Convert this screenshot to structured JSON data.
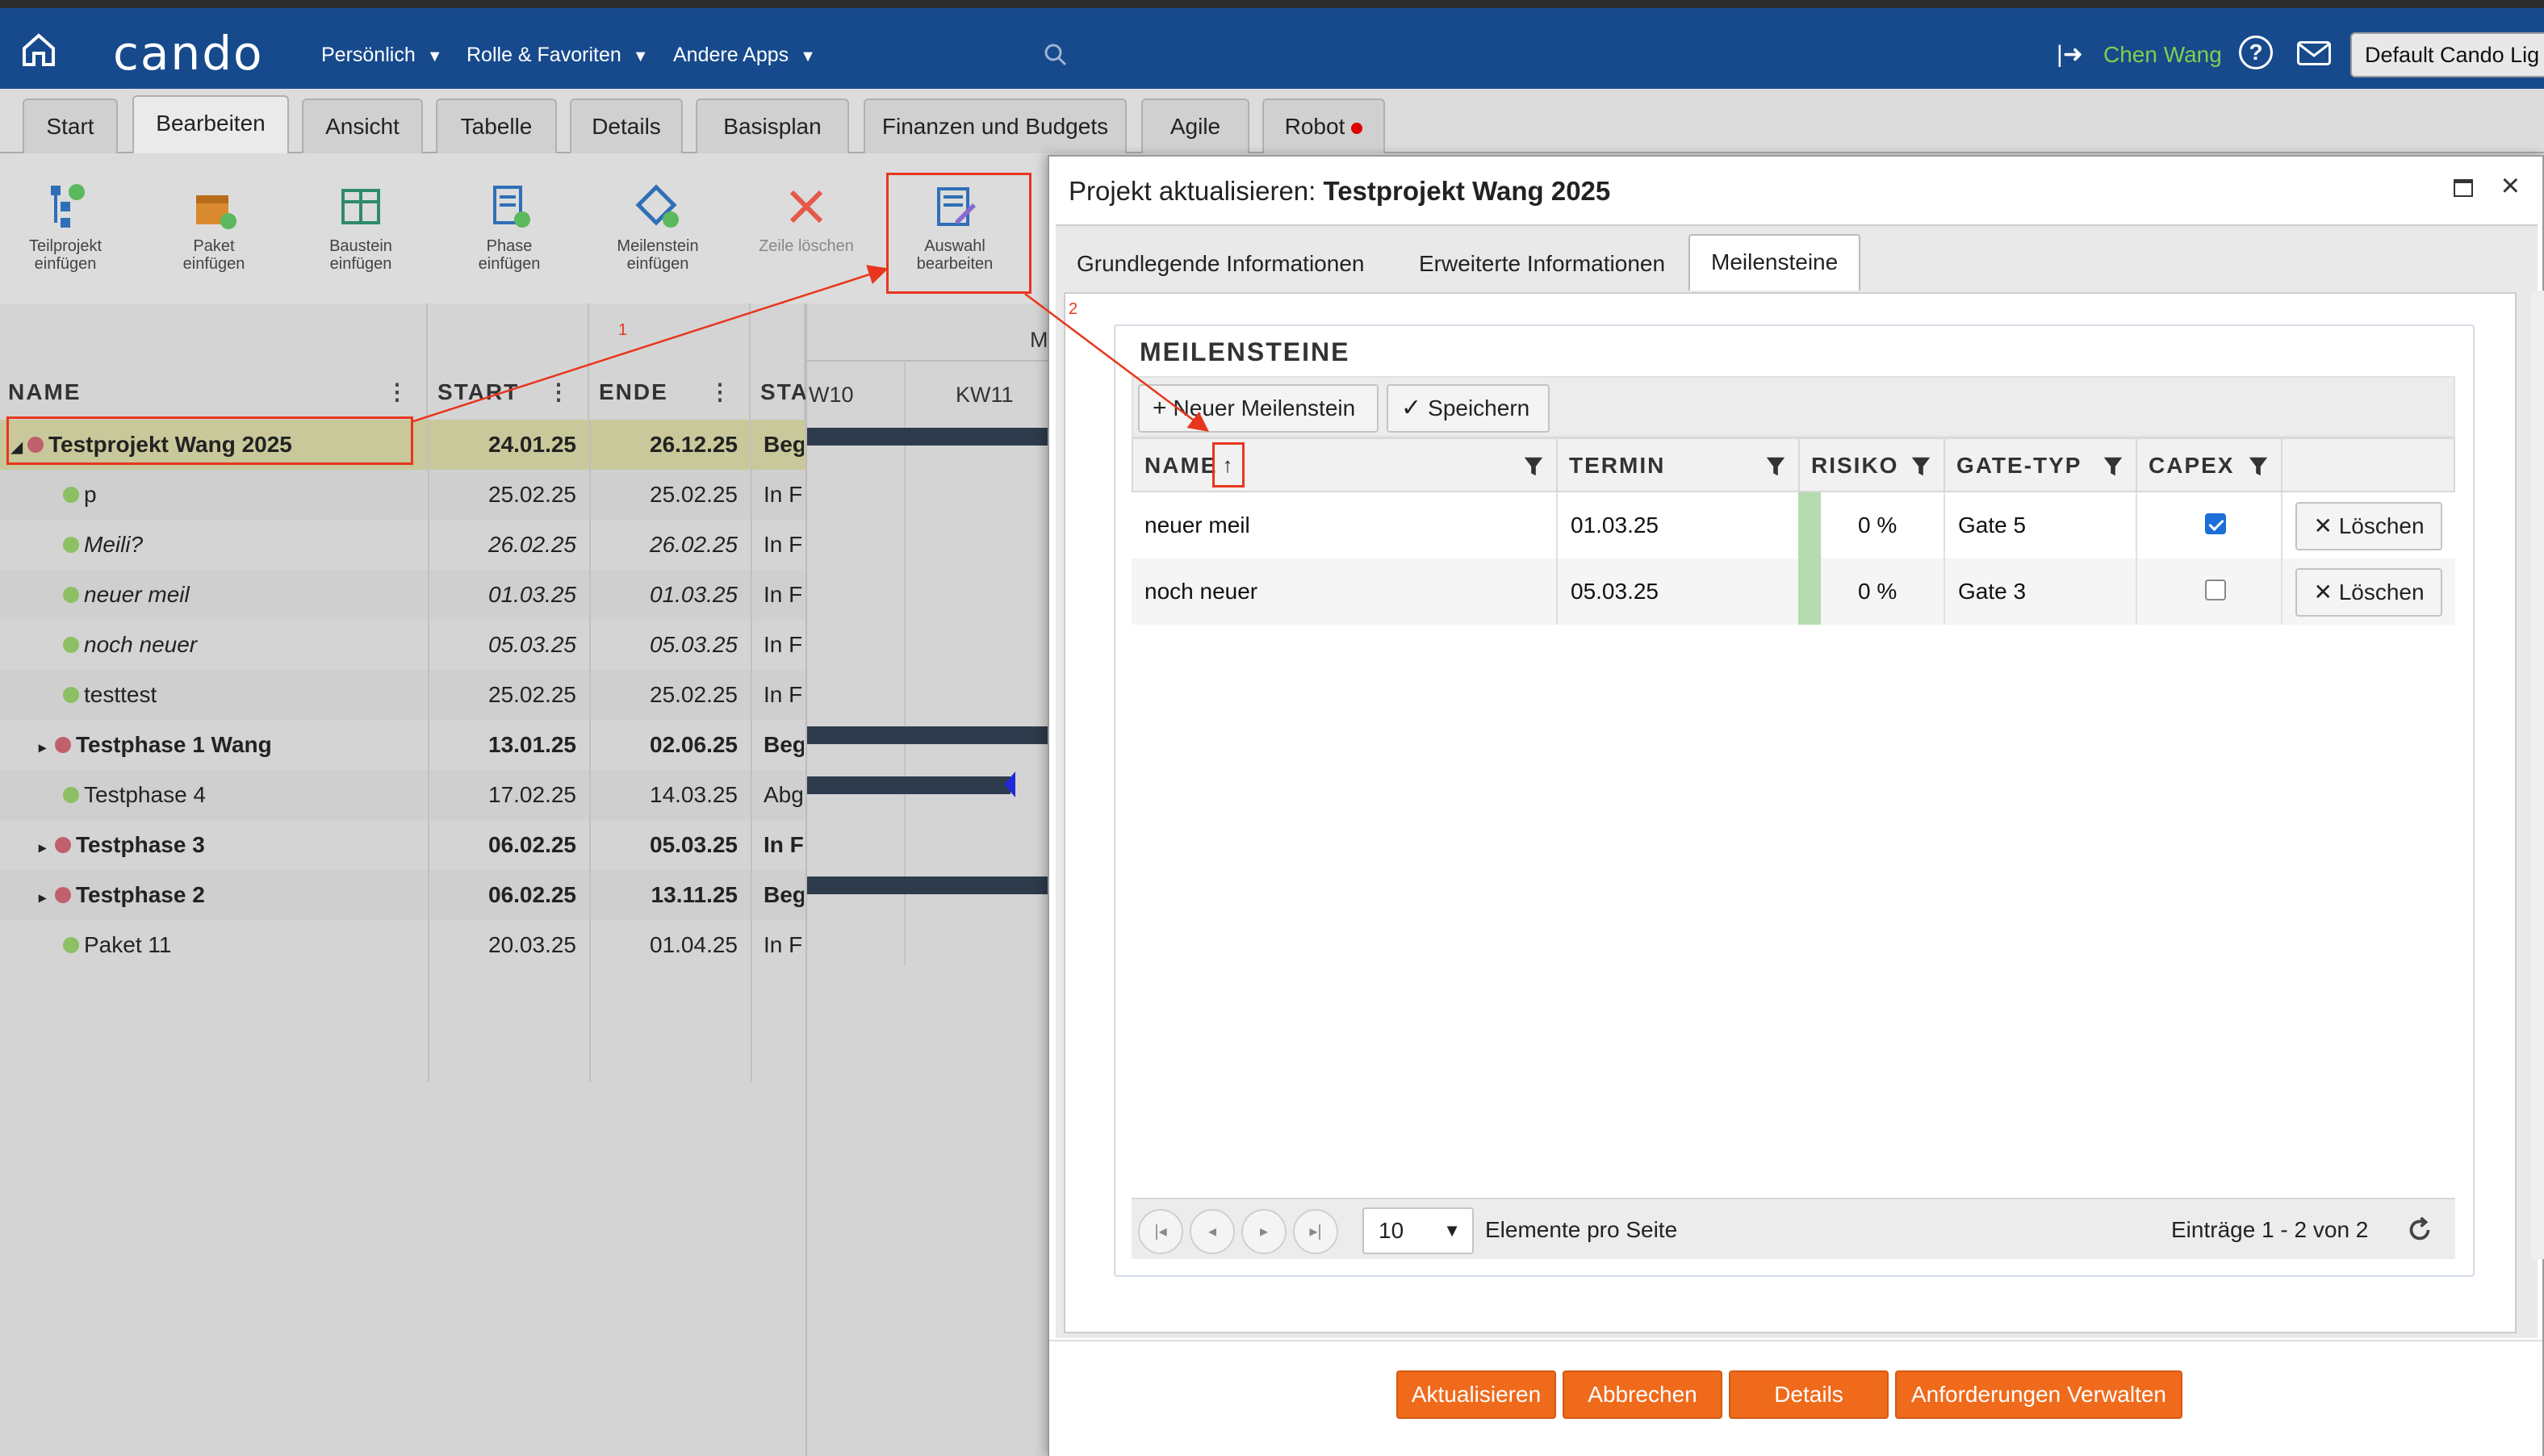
{
  "topnav": {
    "logo": "cando",
    "menu": [
      {
        "label": "Persönlich"
      },
      {
        "label": "Rolle & Favoriten"
      },
      {
        "label": "Andere Apps"
      }
    ],
    "user": "Chen Wang",
    "help": "?",
    "theme": "Default Cando Lig"
  },
  "tabs": [
    "Start",
    "Bearbeiten",
    "Ansicht",
    "Tabelle",
    "Details",
    "Basisplan",
    "Finanzen und Budgets",
    "Agile",
    "Robot"
  ],
  "ribbon": [
    {
      "label1": "Teilprojekt",
      "label2": "einfügen",
      "icon": "subproject-icon"
    },
    {
      "label1": "Paket",
      "label2": "einfügen",
      "icon": "package-icon"
    },
    {
      "label1": "Baustein",
      "label2": "einfügen",
      "icon": "module-icon"
    },
    {
      "label1": "Phase",
      "label2": "einfügen",
      "icon": "phase-icon"
    },
    {
      "label1": "Meilenstein",
      "label2": "einfügen",
      "icon": "milestone-icon"
    },
    {
      "label1": "Zeile löschen",
      "label2": "",
      "icon": "delete-icon"
    },
    {
      "label1": "Auswahl",
      "label2": "bearbeiten",
      "icon": "edit-selection-icon"
    }
  ],
  "grid": {
    "headers": {
      "name": "NAME",
      "start": "START",
      "end": "ENDE",
      "status": "STA"
    },
    "rows": [
      {
        "name": "Testprojekt Wang 2025",
        "start": "24.01.25",
        "end": "26.12.25",
        "status": "Beg",
        "dot": "r",
        "bold": true,
        "italic": false,
        "expander": "◢",
        "indent": 0
      },
      {
        "name": "p",
        "start": "25.02.25",
        "end": "25.02.25",
        "status": "In F",
        "dot": "g",
        "bold": false,
        "italic": false,
        "expander": "",
        "indent": 1
      },
      {
        "name": "Meili?",
        "start": "26.02.25",
        "end": "26.02.25",
        "status": "In F",
        "dot": "g",
        "bold": false,
        "italic": true,
        "expander": "",
        "indent": 1
      },
      {
        "name": "neuer meil",
        "start": "01.03.25",
        "end": "01.03.25",
        "status": "In F",
        "dot": "g",
        "bold": false,
        "italic": true,
        "expander": "",
        "indent": 1
      },
      {
        "name": "noch neuer",
        "start": "05.03.25",
        "end": "05.03.25",
        "status": "In F",
        "dot": "g",
        "bold": false,
        "italic": true,
        "expander": "",
        "indent": 1
      },
      {
        "name": "testtest",
        "start": "25.02.25",
        "end": "25.02.25",
        "status": "In F",
        "dot": "g",
        "bold": false,
        "italic": false,
        "expander": "",
        "indent": 1
      },
      {
        "name": "Testphase 1 Wang",
        "start": "13.01.25",
        "end": "02.06.25",
        "status": "Beg",
        "dot": "r",
        "bold": true,
        "italic": false,
        "expander": "▸",
        "indent": 1
      },
      {
        "name": "Testphase 4",
        "start": "17.02.25",
        "end": "14.03.25",
        "status": "Abg",
        "dot": "g",
        "bold": false,
        "italic": false,
        "expander": "",
        "indent": 1
      },
      {
        "name": "Testphase 3",
        "start": "06.02.25",
        "end": "05.03.25",
        "status": "In F",
        "dot": "r",
        "bold": true,
        "italic": false,
        "expander": "▸",
        "indent": 1
      },
      {
        "name": "Testphase 2",
        "start": "06.02.25",
        "end": "13.11.25",
        "status": "Beg",
        "dot": "r",
        "bold": true,
        "italic": false,
        "expander": "▸",
        "indent": 1
      },
      {
        "name": "Paket 11",
        "start": "20.03.25",
        "end": "01.04.25",
        "status": "In F",
        "dot": "g",
        "bold": false,
        "italic": false,
        "expander": "",
        "indent": 1
      }
    ],
    "gantt": {
      "month": "M",
      "weeks": [
        "W10",
        "KW11"
      ]
    }
  },
  "dialog": {
    "title_prefix": "Projekt aktualisieren: ",
    "title_project": "Testprojekt Wang 2025",
    "close": "×",
    "tabs": [
      "Grundlegende Informationen",
      "Erweiterte Informationen",
      "Meilensteine"
    ],
    "section_title": "MEILENSTEINE",
    "new_button": "Neuer Meilenstein",
    "save_button": "Speichern",
    "columns": {
      "name": "NAME",
      "sort": "↑",
      "termin": "TERMIN",
      "risiko": "RISIKO",
      "gate": "GATE-TYP",
      "capex": "CAPEX"
    },
    "rows": [
      {
        "name": "neuer meil",
        "termin": "01.03.25",
        "risiko": "0 %",
        "gate": "Gate 5",
        "capex": true,
        "delete": "Löschen"
      },
      {
        "name": "noch neuer",
        "termin": "05.03.25",
        "risiko": "0 %",
        "gate": "Gate 3",
        "capex": false,
        "delete": "Löschen"
      }
    ],
    "pager": {
      "page_size": "10",
      "per_page_label": "Elemente pro Seite",
      "summary": "Einträge 1 - 2 von 2"
    },
    "footer_buttons": [
      "Aktualisieren",
      "Abbrechen",
      "Details",
      "Anforderungen Verwalten"
    ]
  },
  "annotations": {
    "step1": "1",
    "step2": "2"
  },
  "colors": {
    "nav": "#174a8c",
    "accent": "#f06a1c",
    "annotation": "#e8361e",
    "user": "#7fd04c"
  }
}
